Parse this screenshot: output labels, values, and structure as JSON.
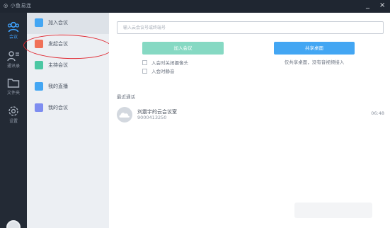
{
  "window": {
    "app_title": "小鱼易连",
    "minimize_glyph": "_",
    "close_glyph": "×"
  },
  "rail": {
    "items": [
      {
        "label": "会议",
        "icon": "meeting-icon",
        "active": true
      },
      {
        "label": "通讯录",
        "icon": "contacts-icon",
        "active": false
      },
      {
        "label": "文件夹",
        "icon": "folder-icon",
        "active": false
      },
      {
        "label": "设置",
        "icon": "gear-icon",
        "active": false
      }
    ]
  },
  "menu": {
    "items": [
      {
        "label": "加入会议",
        "icon": "join-meeting-icon",
        "color": "#43a6f3"
      },
      {
        "label": "发起会议",
        "icon": "start-meeting-icon",
        "color": "#f07158"
      },
      {
        "label": "主持会议",
        "icon": "host-meeting-icon",
        "color": "#4cc7a3"
      },
      {
        "label": "我的直播",
        "icon": "live-icon",
        "color": "#43a6f3"
      },
      {
        "label": "我的会议",
        "icon": "my-meeting-icon",
        "color": "#7e8df0"
      }
    ]
  },
  "main": {
    "search_placeholder": "输入云会议号或终端号",
    "join_button": "加入会议",
    "share_button": "共享桌面",
    "options": [
      "入会时关闭摄像头",
      "入会时静音"
    ],
    "share_description": "仅共享桌面，没有音视频接入",
    "recent_title": "最近通话",
    "recent_calls": [
      {
        "name": "刘震宇的云会议室",
        "number": "9000413250",
        "time": "06:48"
      }
    ]
  },
  "colors": {
    "titlebar": "#1f2631",
    "rail": "#232a35",
    "menu": "#eceff3",
    "accent_blue": "#43a6f3",
    "join_green": "#86d9c3",
    "annotation_red": "#e0262f"
  }
}
